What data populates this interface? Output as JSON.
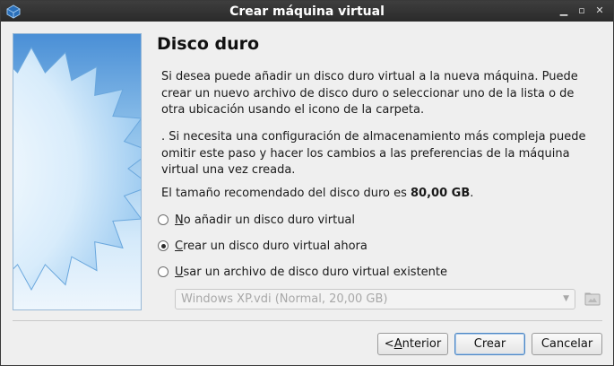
{
  "window": {
    "title": "Crear máquina virtual"
  },
  "page": {
    "heading": "Disco duro",
    "para1": "Si desea puede añadir un disco duro virtual a la nueva máquina. Puede crear un nuevo archivo de disco duro o seleccionar uno de la lista o de otra ubicación usando el icono de la carpeta.",
    "para2": ". Si necesita una configuración de almacenamiento más compleja puede omitir este paso y hacer los cambios a las preferencias de la máquina virtual una vez creada.",
    "recommended_prefix": "El tamaño recomendado del disco duro es ",
    "recommended_size": "80,00 GB",
    "recommended_suffix": "."
  },
  "options": [
    {
      "mnemonic": "N",
      "rest": "o añadir un disco duro virtual",
      "checked": false
    },
    {
      "mnemonic": "C",
      "rest": "rear un disco duro virtual ahora",
      "checked": true
    },
    {
      "mnemonic": "U",
      "rest": "sar un archivo de disco duro virtual existente",
      "checked": false
    }
  ],
  "existing_disk": {
    "value": "Windows XP.vdi (Normal, 20,00 GB)",
    "enabled": false
  },
  "icons": {
    "app": "virtualbox-icon",
    "folder": "folder-icon",
    "combo": "chevron-down-icon"
  },
  "buttons": {
    "back_prefix": "< ",
    "back_mnemonic": "A",
    "back_rest": "nterior",
    "create": "Crear",
    "cancel": "Cancelar"
  },
  "colors": {
    "titlebar": "#2f2f2f",
    "default_button_border": "#4c87c5",
    "panel_blue": "#4a8fd6"
  }
}
